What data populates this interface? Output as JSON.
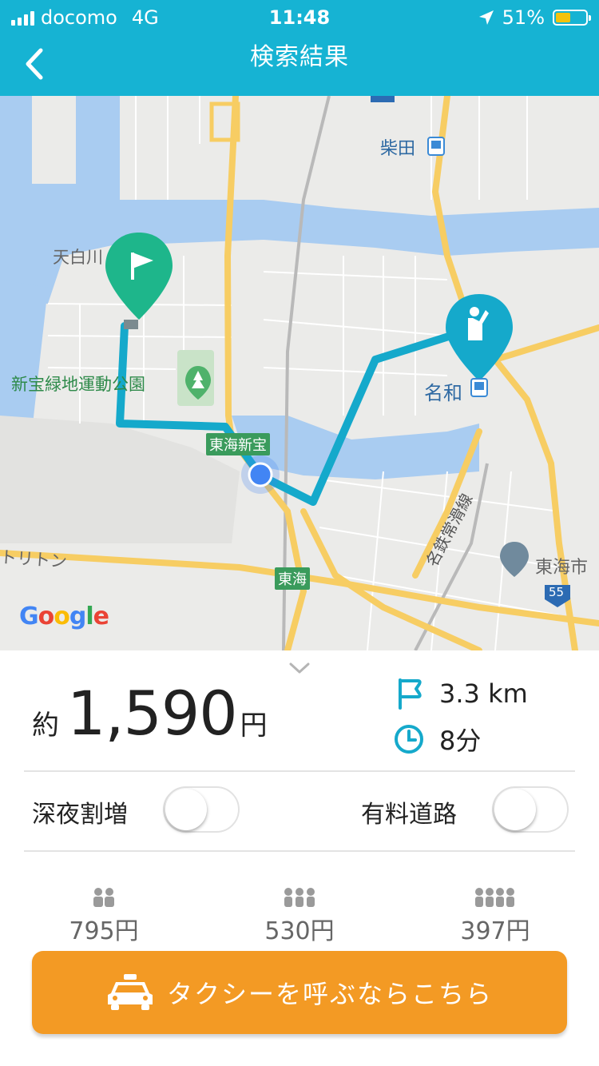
{
  "status_bar": {
    "carrier": "docomo",
    "network": "4G",
    "time": "11:48",
    "battery": "51%",
    "battery_level": 0.51
  },
  "header": {
    "title": "検索結果"
  },
  "map": {
    "labels": {
      "shibata": "柴田",
      "tenpaku": "天白川",
      "park": "新宝緑地運動公園",
      "nawa": "名和",
      "tokai_shinpo": "東海新宝",
      "meitetsu": "名鉄常滑線",
      "tokai_city": "東海市",
      "toritton": "トリトン",
      "tokai": "東海",
      "route_55": "55"
    },
    "google": [
      "G",
      "o",
      "o",
      "g",
      "l",
      "e"
    ],
    "google_colors": [
      "#4285F4",
      "#EA4335",
      "#FBBC05",
      "#4285F4",
      "#34A853",
      "#EA4335"
    ]
  },
  "summary": {
    "fare_prefix": "約",
    "fare_amount": "1,590",
    "fare_unit": "円",
    "distance": "3.3 km",
    "duration": "8分"
  },
  "options": {
    "late_night": "深夜割増",
    "toll_road": "有料道路"
  },
  "split_fares": [
    {
      "people": 2,
      "price": "795円"
    },
    {
      "people": 3,
      "price": "530円"
    },
    {
      "people": 4,
      "price": "397円"
    }
  ],
  "cta": {
    "label": "タクシーを呼ぶならこちら"
  },
  "colors": {
    "brand": "#16b3d3",
    "route": "#15a9cb",
    "cta": "#f39a24",
    "destination_pin": "#1eb68b"
  }
}
